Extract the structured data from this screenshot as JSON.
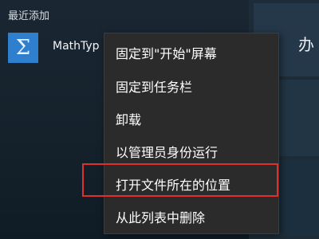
{
  "start_menu": {
    "recent_header": "最近添加",
    "recent_app": {
      "name": "MathTyp",
      "icon": "sigma-icon"
    },
    "tile_glyph": "办"
  },
  "context_menu": {
    "items": [
      {
        "label": "固定到\"开始\"屏幕"
      },
      {
        "label": "固定到任务栏"
      },
      {
        "label": "卸载"
      },
      {
        "label": "以管理员身份运行"
      },
      {
        "label": "打开文件所在的位置",
        "highlighted": true
      },
      {
        "label": "从此列表中删除"
      }
    ]
  },
  "colors": {
    "tile_blue": "#2f7fcf",
    "menu_bg": "#2b2b2b",
    "highlight_border": "#e0302d"
  }
}
